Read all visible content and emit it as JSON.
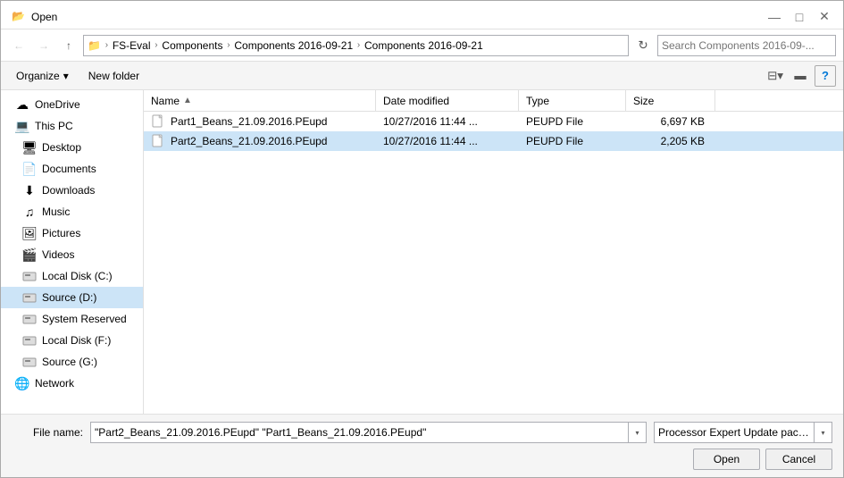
{
  "dialog": {
    "title": "Open",
    "close_btn": "✕",
    "minimize_btn": "—",
    "maximize_btn": "□"
  },
  "addressbar": {
    "back_tooltip": "Back",
    "forward_tooltip": "Forward",
    "up_tooltip": "Up",
    "breadcrumbs": [
      "FS-Eval",
      "Components",
      "Components 2016-09-21",
      "Components 2016-09-21"
    ],
    "search_placeholder": "Search Components 2016-09-...",
    "refresh_tooltip": "Refresh"
  },
  "toolbar": {
    "organize_label": "Organize",
    "new_folder_label": "New folder",
    "view_icon": "⊞",
    "details_icon": "≡",
    "help_label": "?"
  },
  "sidebar": {
    "items": [
      {
        "label": "OneDrive",
        "icon": "☁",
        "indent": 0
      },
      {
        "label": "This PC",
        "icon": "💻",
        "indent": 0
      },
      {
        "label": "Desktop",
        "icon": "🖥",
        "indent": 1
      },
      {
        "label": "Documents",
        "icon": "📄",
        "indent": 1
      },
      {
        "label": "Downloads",
        "icon": "⬇",
        "indent": 1
      },
      {
        "label": "Music",
        "icon": "♫",
        "indent": 1
      },
      {
        "label": "Pictures",
        "icon": "🖼",
        "indent": 1
      },
      {
        "label": "Videos",
        "icon": "🎬",
        "indent": 1
      },
      {
        "label": "Local Disk (C:)",
        "icon": "💾",
        "indent": 1
      },
      {
        "label": "Source (D:)",
        "icon": "💾",
        "indent": 1,
        "selected": true
      },
      {
        "label": "System Reserved",
        "icon": "💾",
        "indent": 1
      },
      {
        "label": "Local Disk (F:)",
        "icon": "💾",
        "indent": 1
      },
      {
        "label": "Source (G:)",
        "icon": "💾",
        "indent": 1
      },
      {
        "label": "Network",
        "icon": "🌐",
        "indent": 0
      }
    ]
  },
  "file_list": {
    "columns": [
      {
        "label": "Name",
        "sort_arrow": "▲"
      },
      {
        "label": "Date modified",
        "sort_arrow": ""
      },
      {
        "label": "Type",
        "sort_arrow": ""
      },
      {
        "label": "Size",
        "sort_arrow": ""
      }
    ],
    "files": [
      {
        "name": "Part1_Beans_21.09.2016.PEupd",
        "date": "10/27/2016 11:44 ...",
        "type": "PEUPD File",
        "size": "6,697 KB",
        "selected": false
      },
      {
        "name": "Part2_Beans_21.09.2016.PEupd",
        "date": "10/27/2016 11:44 ...",
        "type": "PEUPD File",
        "size": "2,205 KB",
        "selected": true
      }
    ]
  },
  "bottom": {
    "filename_label": "File name:",
    "filename_value": "\"Part2_Beans_21.09.2016.PEupd\" \"Part1_Beans_21.09.2016.PEupd\"",
    "filetype_value": "Processor Expert Update packa...",
    "open_btn": "Open",
    "cancel_btn": "Cancel"
  }
}
